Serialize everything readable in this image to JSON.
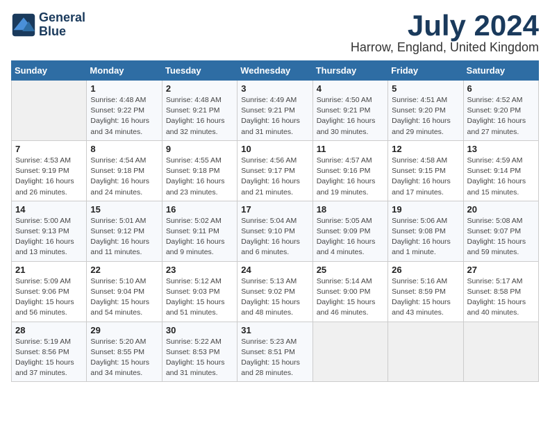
{
  "header": {
    "logo_line1": "General",
    "logo_line2": "Blue",
    "month_year": "July 2024",
    "location": "Harrow, England, United Kingdom"
  },
  "days_of_week": [
    "Sunday",
    "Monday",
    "Tuesday",
    "Wednesday",
    "Thursday",
    "Friday",
    "Saturday"
  ],
  "weeks": [
    [
      {
        "day": "",
        "info": ""
      },
      {
        "day": "1",
        "info": "Sunrise: 4:48 AM\nSunset: 9:22 PM\nDaylight: 16 hours\nand 34 minutes."
      },
      {
        "day": "2",
        "info": "Sunrise: 4:48 AM\nSunset: 9:21 PM\nDaylight: 16 hours\nand 32 minutes."
      },
      {
        "day": "3",
        "info": "Sunrise: 4:49 AM\nSunset: 9:21 PM\nDaylight: 16 hours\nand 31 minutes."
      },
      {
        "day": "4",
        "info": "Sunrise: 4:50 AM\nSunset: 9:21 PM\nDaylight: 16 hours\nand 30 minutes."
      },
      {
        "day": "5",
        "info": "Sunrise: 4:51 AM\nSunset: 9:20 PM\nDaylight: 16 hours\nand 29 minutes."
      },
      {
        "day": "6",
        "info": "Sunrise: 4:52 AM\nSunset: 9:20 PM\nDaylight: 16 hours\nand 27 minutes."
      }
    ],
    [
      {
        "day": "7",
        "info": "Sunrise: 4:53 AM\nSunset: 9:19 PM\nDaylight: 16 hours\nand 26 minutes."
      },
      {
        "day": "8",
        "info": "Sunrise: 4:54 AM\nSunset: 9:18 PM\nDaylight: 16 hours\nand 24 minutes."
      },
      {
        "day": "9",
        "info": "Sunrise: 4:55 AM\nSunset: 9:18 PM\nDaylight: 16 hours\nand 23 minutes."
      },
      {
        "day": "10",
        "info": "Sunrise: 4:56 AM\nSunset: 9:17 PM\nDaylight: 16 hours\nand 21 minutes."
      },
      {
        "day": "11",
        "info": "Sunrise: 4:57 AM\nSunset: 9:16 PM\nDaylight: 16 hours\nand 19 minutes."
      },
      {
        "day": "12",
        "info": "Sunrise: 4:58 AM\nSunset: 9:15 PM\nDaylight: 16 hours\nand 17 minutes."
      },
      {
        "day": "13",
        "info": "Sunrise: 4:59 AM\nSunset: 9:14 PM\nDaylight: 16 hours\nand 15 minutes."
      }
    ],
    [
      {
        "day": "14",
        "info": "Sunrise: 5:00 AM\nSunset: 9:13 PM\nDaylight: 16 hours\nand 13 minutes."
      },
      {
        "day": "15",
        "info": "Sunrise: 5:01 AM\nSunset: 9:12 PM\nDaylight: 16 hours\nand 11 minutes."
      },
      {
        "day": "16",
        "info": "Sunrise: 5:02 AM\nSunset: 9:11 PM\nDaylight: 16 hours\nand 9 minutes."
      },
      {
        "day": "17",
        "info": "Sunrise: 5:04 AM\nSunset: 9:10 PM\nDaylight: 16 hours\nand 6 minutes."
      },
      {
        "day": "18",
        "info": "Sunrise: 5:05 AM\nSunset: 9:09 PM\nDaylight: 16 hours\nand 4 minutes."
      },
      {
        "day": "19",
        "info": "Sunrise: 5:06 AM\nSunset: 9:08 PM\nDaylight: 16 hours\nand 1 minute."
      },
      {
        "day": "20",
        "info": "Sunrise: 5:08 AM\nSunset: 9:07 PM\nDaylight: 15 hours\nand 59 minutes."
      }
    ],
    [
      {
        "day": "21",
        "info": "Sunrise: 5:09 AM\nSunset: 9:06 PM\nDaylight: 15 hours\nand 56 minutes."
      },
      {
        "day": "22",
        "info": "Sunrise: 5:10 AM\nSunset: 9:04 PM\nDaylight: 15 hours\nand 54 minutes."
      },
      {
        "day": "23",
        "info": "Sunrise: 5:12 AM\nSunset: 9:03 PM\nDaylight: 15 hours\nand 51 minutes."
      },
      {
        "day": "24",
        "info": "Sunrise: 5:13 AM\nSunset: 9:02 PM\nDaylight: 15 hours\nand 48 minutes."
      },
      {
        "day": "25",
        "info": "Sunrise: 5:14 AM\nSunset: 9:00 PM\nDaylight: 15 hours\nand 46 minutes."
      },
      {
        "day": "26",
        "info": "Sunrise: 5:16 AM\nSunset: 8:59 PM\nDaylight: 15 hours\nand 43 minutes."
      },
      {
        "day": "27",
        "info": "Sunrise: 5:17 AM\nSunset: 8:58 PM\nDaylight: 15 hours\nand 40 minutes."
      }
    ],
    [
      {
        "day": "28",
        "info": "Sunrise: 5:19 AM\nSunset: 8:56 PM\nDaylight: 15 hours\nand 37 minutes."
      },
      {
        "day": "29",
        "info": "Sunrise: 5:20 AM\nSunset: 8:55 PM\nDaylight: 15 hours\nand 34 minutes."
      },
      {
        "day": "30",
        "info": "Sunrise: 5:22 AM\nSunset: 8:53 PM\nDaylight: 15 hours\nand 31 minutes."
      },
      {
        "day": "31",
        "info": "Sunrise: 5:23 AM\nSunset: 8:51 PM\nDaylight: 15 hours\nand 28 minutes."
      },
      {
        "day": "",
        "info": ""
      },
      {
        "day": "",
        "info": ""
      },
      {
        "day": "",
        "info": ""
      }
    ]
  ]
}
